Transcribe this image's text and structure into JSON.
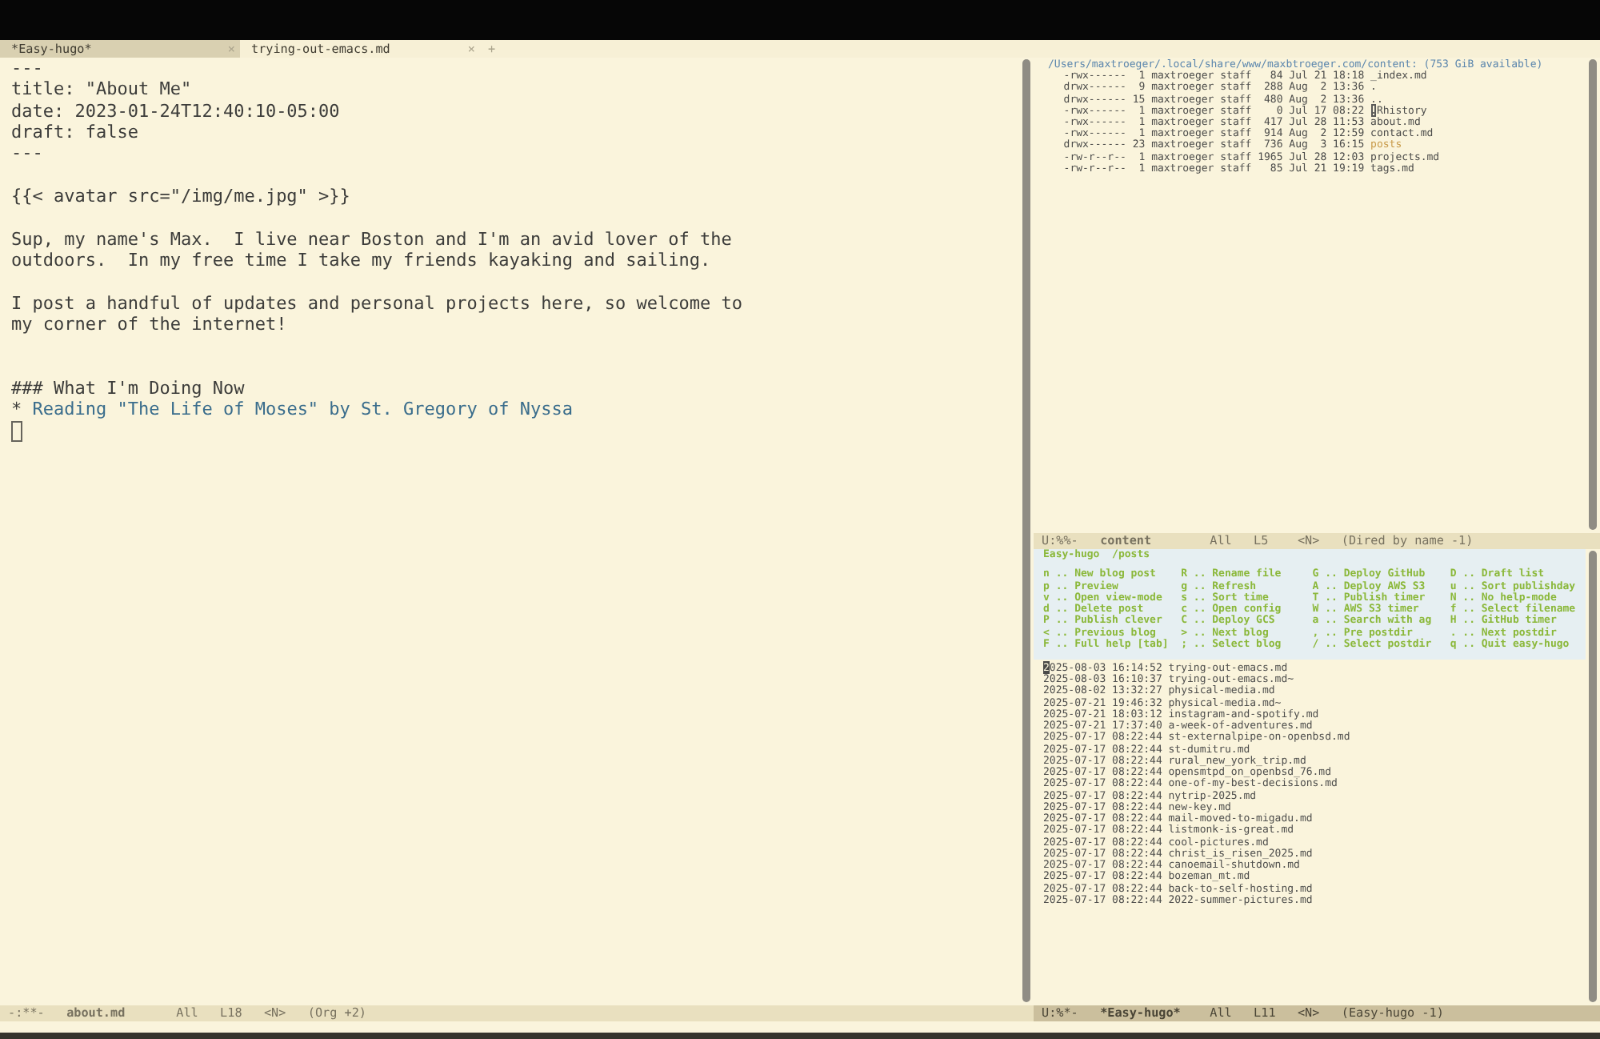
{
  "tab_bar": {
    "tabs": [
      {
        "label": "*Easy-hugo*",
        "close": "×",
        "selected": true
      },
      {
        "label": "trying-out-emacs.md",
        "close": "×",
        "selected": false
      }
    ],
    "new_tab": "+"
  },
  "editor": {
    "active": false,
    "lines": [
      {
        "kind": "text",
        "text": "---"
      },
      {
        "kind": "text",
        "text": "title: \"About Me\""
      },
      {
        "kind": "text",
        "text": "date: 2023-01-24T12:40:10-05:00"
      },
      {
        "kind": "text",
        "text": "draft: false"
      },
      {
        "kind": "text",
        "text": "---"
      },
      {
        "kind": "blank"
      },
      {
        "kind": "text",
        "text": "{{< avatar src=\"/img/me.jpg\" >}}"
      },
      {
        "kind": "blank"
      },
      {
        "kind": "text",
        "text": "Sup, my name's Max.  I live near Boston and I'm an avid lover of the"
      },
      {
        "kind": "text",
        "text": "outdoors.  In my free time I take my friends kayaking and sailing."
      },
      {
        "kind": "blank"
      },
      {
        "kind": "text",
        "text": "I post a handful of updates and personal projects here, so welcome to"
      },
      {
        "kind": "text",
        "text": "my corner of the internet!"
      },
      {
        "kind": "blank"
      },
      {
        "kind": "blank"
      },
      {
        "kind": "text",
        "text": "### What I'm Doing Now"
      },
      {
        "kind": "bullet",
        "marker": "*",
        "text": "Reading \"The Life of Moses\" by St. Gregory of Nyssa"
      },
      {
        "kind": "cursor"
      }
    ],
    "mode_line": {
      "status": "-:**-",
      "buffer": "about.md",
      "position": "All",
      "line": "L18",
      "state": "<N>",
      "modes": "(Org +2)"
    }
  },
  "dired": {
    "active": false,
    "header": "/Users/maxtroeger/.local/share/www/maxbtroeger.com/content: (753 GiB available)",
    "entries": [
      {
        "info": "-rwx------  1 maxtroeger staff   84 Jul 21 18:18",
        "name": "_index.md",
        "kind": "file",
        "cursor": false
      },
      {
        "info": "drwx------  9 maxtroeger staff  288 Aug  2 13:36",
        "name": ".",
        "kind": "dot",
        "cursor": false
      },
      {
        "info": "drwx------ 15 maxtroeger staff  480 Aug  2 13:36",
        "name": "..",
        "kind": "dot",
        "cursor": false
      },
      {
        "info": "-rwx------  1 maxtroeger staff    0 Jul 17 08:22",
        "name": ".Rhistory",
        "kind": "file",
        "cursor": true
      },
      {
        "info": "-rwx------  1 maxtroeger staff  417 Jul 28 11:53",
        "name": "about.md",
        "kind": "file",
        "cursor": false
      },
      {
        "info": "-rwx------  1 maxtroeger staff  914 Aug  2 12:59",
        "name": "contact.md",
        "kind": "file",
        "cursor": false
      },
      {
        "info": "drwx------ 23 maxtroeger staff  736 Aug  3 16:15",
        "name": "posts",
        "kind": "directory",
        "cursor": false
      },
      {
        "info": "-rw-r--r--  1 maxtroeger staff 1965 Jul 28 12:03",
        "name": "projects.md",
        "kind": "file",
        "cursor": false
      },
      {
        "info": "-rw-r--r--  1 maxtroeger staff   85 Jul 21 19:19",
        "name": "tags.md",
        "kind": "file",
        "cursor": false
      }
    ],
    "mode_line": {
      "status": "U:%%-",
      "buffer": "content",
      "position": "All",
      "line": "L5",
      "state": "<N>",
      "modes": "(Dired by name -1)"
    }
  },
  "easy_hugo": {
    "active": true,
    "title": "Easy-hugo",
    "directory": "/posts",
    "help_rows": [
      [
        "n .. New blog post",
        "R .. Rename file",
        "G .. Deploy GitHub",
        "D .. Draft list"
      ],
      [
        "p .. Preview",
        "g .. Refresh",
        "A .. Deploy AWS S3",
        "u .. Sort publishday"
      ],
      [
        "v .. Open view-mode",
        "s .. Sort time",
        "T .. Publish timer",
        "N .. No help-mode"
      ],
      [
        "d .. Delete post",
        "c .. Open config",
        "W .. AWS S3 timer",
        "f .. Select filename"
      ],
      [
        "P .. Publish clever",
        "C .. Deploy GCS",
        "a .. Search with ag",
        "H .. GitHub timer"
      ],
      [
        "< .. Previous blog",
        "> .. Next blog",
        ", .. Pre postdir",
        ". .. Next postdir"
      ],
      [
        "F .. Full help [tab]",
        "; .. Select blog",
        "/ .. Select postdir",
        "q .. Quit easy-hugo"
      ]
    ],
    "files": [
      {
        "text": "2025-08-03 16:14:52 trying-out-emacs.md",
        "cursor": true
      },
      {
        "text": "2025-08-03 16:10:37 trying-out-emacs.md~",
        "cursor": false
      },
      {
        "text": "2025-08-02 13:32:27 physical-media.md",
        "cursor": false
      },
      {
        "text": "2025-07-21 19:46:32 physical-media.md~",
        "cursor": false
      },
      {
        "text": "2025-07-21 18:03:12 instagram-and-spotify.md",
        "cursor": false
      },
      {
        "text": "2025-07-21 17:37:40 a-week-of-adventures.md",
        "cursor": false
      },
      {
        "text": "2025-07-17 08:22:44 st-externalpipe-on-openbsd.md",
        "cursor": false
      },
      {
        "text": "2025-07-17 08:22:44 st-dumitru.md",
        "cursor": false
      },
      {
        "text": "2025-07-17 08:22:44 rural_new_york_trip.md",
        "cursor": false
      },
      {
        "text": "2025-07-17 08:22:44 opensmtpd_on_openbsd_76.md",
        "cursor": false
      },
      {
        "text": "2025-07-17 08:22:44 one-of-my-best-decisions.md",
        "cursor": false
      },
      {
        "text": "2025-07-17 08:22:44 nytrip-2025.md",
        "cursor": false
      },
      {
        "text": "2025-07-17 08:22:44 new-key.md",
        "cursor": false
      },
      {
        "text": "2025-07-17 08:22:44 mail-moved-to-migadu.md",
        "cursor": false
      },
      {
        "text": "2025-07-17 08:22:44 listmonk-is-great.md",
        "cursor": false
      },
      {
        "text": "2025-07-17 08:22:44 cool-pictures.md",
        "cursor": false
      },
      {
        "text": "2025-07-17 08:22:44 christ_is_risen_2025.md",
        "cursor": false
      },
      {
        "text": "2025-07-17 08:22:44 canoemail-shutdown.md",
        "cursor": false
      },
      {
        "text": "2025-07-17 08:22:44 bozeman_mt.md",
        "cursor": false
      },
      {
        "text": "2025-07-17 08:22:44 back-to-self-hosting.md",
        "cursor": false
      },
      {
        "text": "2025-07-17 08:22:44 2022-summer-pictures.md",
        "cursor": false
      }
    ],
    "mode_line": {
      "status": "U:%*-",
      "buffer": "*Easy-hugo*",
      "position": "All",
      "line": "L11",
      "state": "<N>",
      "modes": "(Easy-hugo -1)"
    }
  }
}
